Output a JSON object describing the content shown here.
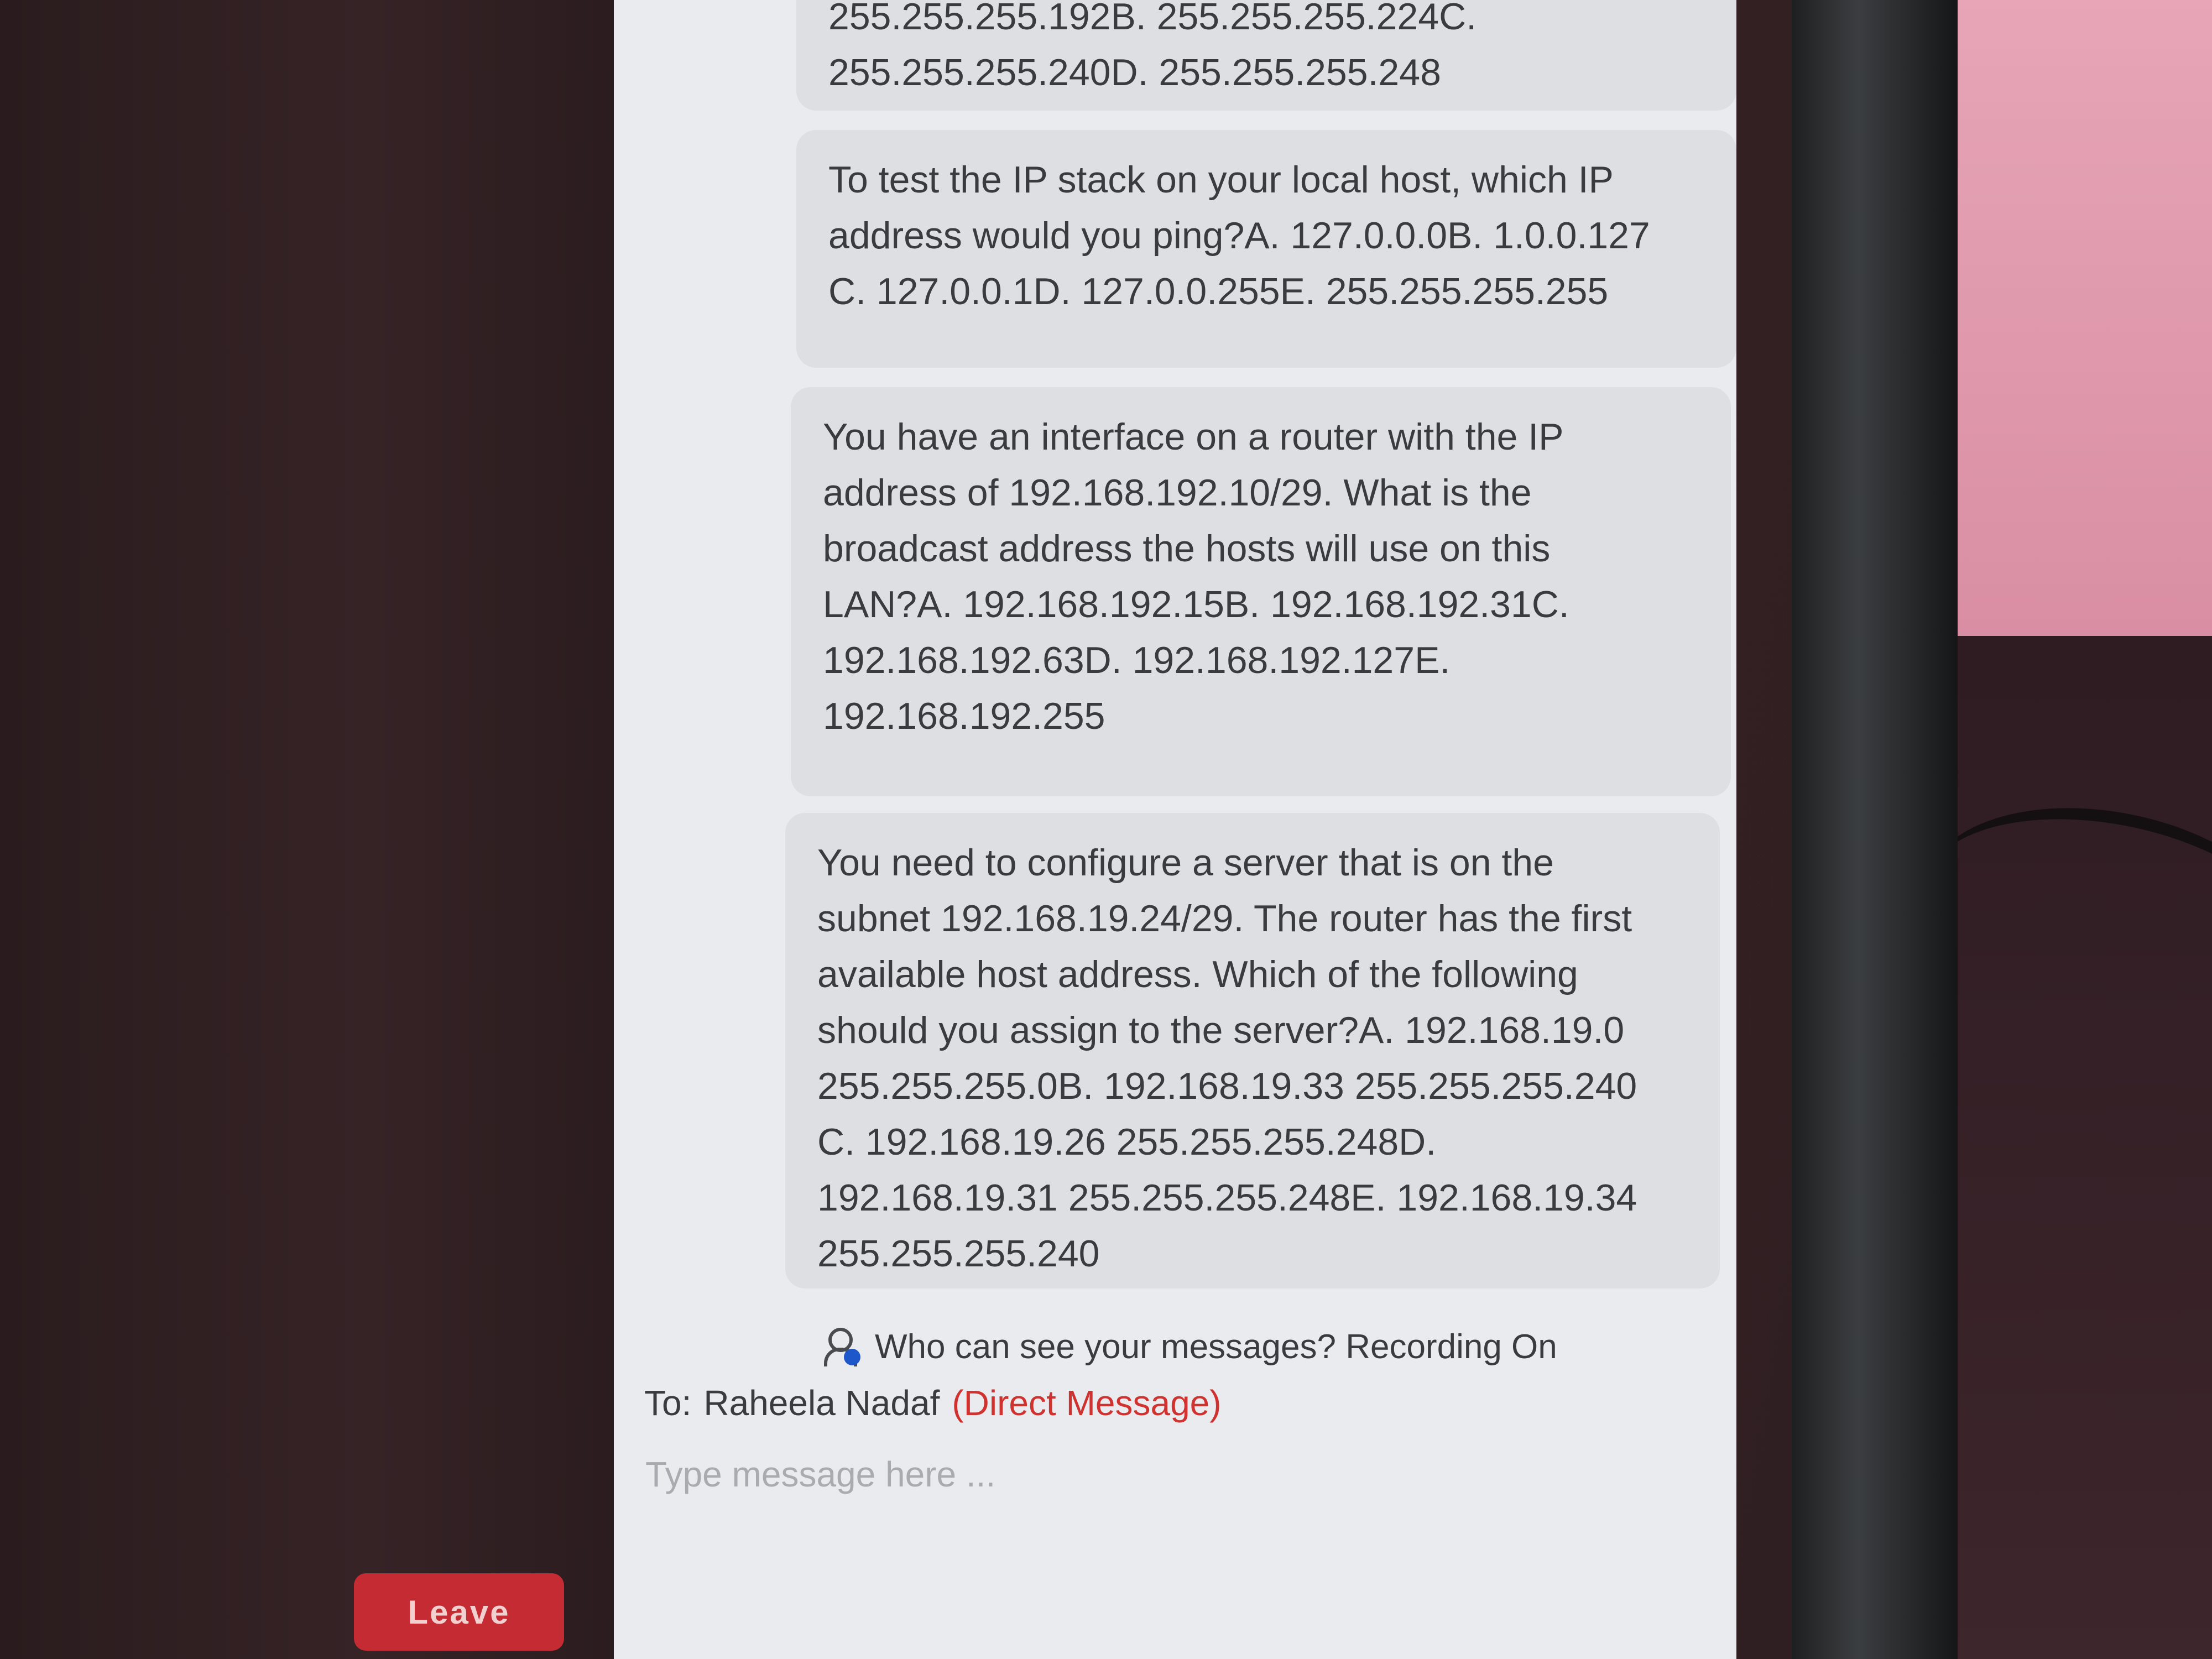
{
  "chat": {
    "messages": [
      {
        "text": "255.255.255.192B. 255.255.255.224C.\n255.255.255.240D. 255.255.255.248"
      },
      {
        "text": "To test the IP stack on your local host, which IP\naddress would you ping?A. 127.0.0.0B. 1.0.0.127\nC. 127.0.0.1D. 127.0.0.255E. 255.255.255.255"
      },
      {
        "text": "You have an interface on a router with the IP\naddress of 192.168.192.10/29. What is the\nbroadcast address the hosts will use on this\nLAN?A. 192.168.192.15B. 192.168.192.31C.\n192.168.192.63D. 192.168.192.127E.\n192.168.192.255"
      },
      {
        "text": "You need to configure a server that is on the\nsubnet 192.168.19.24/29. The router has the first\navailable host address. Which of the following\nshould you assign to the server?A. 192.168.19.0\n255.255.255.0B. 192.168.19.33 255.255.255.240\nC. 192.168.19.26 255.255.255.248D.\n192.168.19.31 255.255.255.248E. 192.168.19.34\n255.255.255.240"
      }
    ],
    "notice": "Who can see your messages? Recording On",
    "to_label": "To:",
    "recipient": "Raheela Nadaf",
    "dm_tag": "(Direct Message)",
    "input_placeholder": "Type message here ...",
    "leave_label": "Leave"
  },
  "icons": {
    "notice_icon": "person-visibility-icon"
  },
  "colors": {
    "leave_button": "#c42b33",
    "direct_message": "#d0322f",
    "message_bubble": "#dddfe3"
  }
}
